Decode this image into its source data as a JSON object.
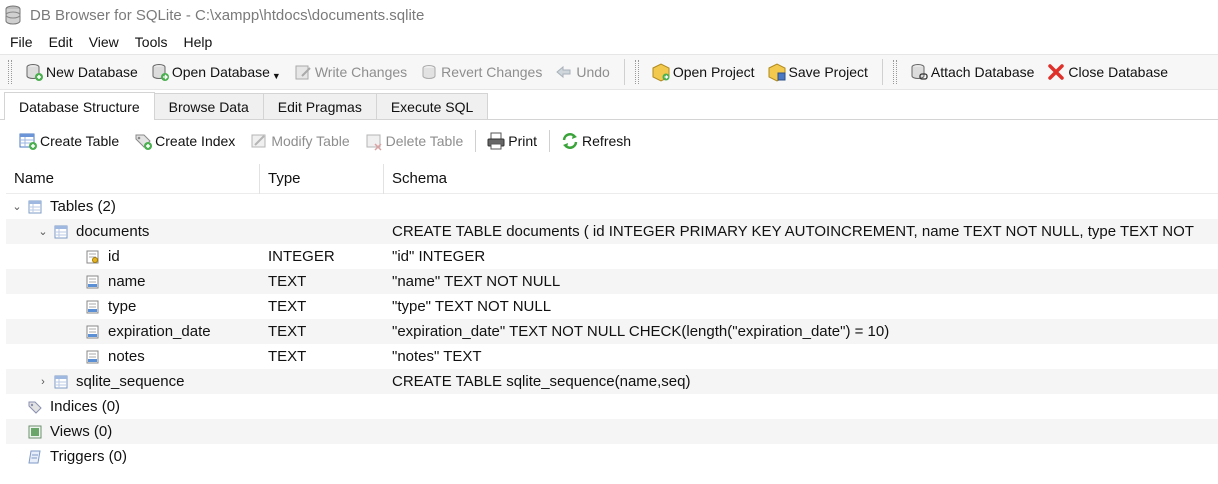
{
  "window": {
    "title": "DB Browser for SQLite - C:\\xampp\\htdocs\\documents.sqlite"
  },
  "menu": [
    "File",
    "Edit",
    "View",
    "Tools",
    "Help"
  ],
  "toolbar": {
    "new_database": "New Database",
    "open_database": "Open Database",
    "write_changes": "Write Changes",
    "revert_changes": "Revert Changes",
    "undo": "Undo",
    "open_project": "Open Project",
    "save_project": "Save Project",
    "attach_database": "Attach Database",
    "close_database": "Close Database"
  },
  "tabs": [
    "Database Structure",
    "Browse Data",
    "Edit Pragmas",
    "Execute SQL"
  ],
  "structure_toolbar": {
    "create_table": "Create Table",
    "create_index": "Create Index",
    "modify_table": "Modify Table",
    "delete_table": "Delete Table",
    "print": "Print",
    "refresh": "Refresh"
  },
  "tree": {
    "columns": {
      "name": "Name",
      "type": "Type",
      "schema": "Schema"
    },
    "tables_node": "Tables (2)",
    "documents": {
      "name": "documents",
      "schema": "CREATE TABLE documents ( id INTEGER PRIMARY KEY AUTOINCREMENT, name TEXT NOT NULL, type TEXT NOT",
      "fields": [
        {
          "name": "id",
          "type": "INTEGER",
          "schema": "\"id\" INTEGER",
          "key": true
        },
        {
          "name": "name",
          "type": "TEXT",
          "schema": "\"name\" TEXT NOT NULL",
          "key": false
        },
        {
          "name": "type",
          "type": "TEXT",
          "schema": "\"type\" TEXT NOT NULL",
          "key": false
        },
        {
          "name": "expiration_date",
          "type": "TEXT",
          "schema": "\"expiration_date\" TEXT NOT NULL CHECK(length(\"expiration_date\") = 10)",
          "key": false
        },
        {
          "name": "notes",
          "type": "TEXT",
          "schema": "\"notes\" TEXT",
          "key": false
        }
      ]
    },
    "sqlite_sequence": {
      "name": "sqlite_sequence",
      "schema": "CREATE TABLE sqlite_sequence(name,seq)"
    },
    "indices_node": "Indices (0)",
    "views_node": "Views (0)",
    "triggers_node": "Triggers (0)"
  },
  "colors": {
    "toolbar_bg": "#f7f7f7",
    "alt_row": "#f5f5f5",
    "disabled_text": "#8e8e8e",
    "close_icon": "#e0302a"
  }
}
